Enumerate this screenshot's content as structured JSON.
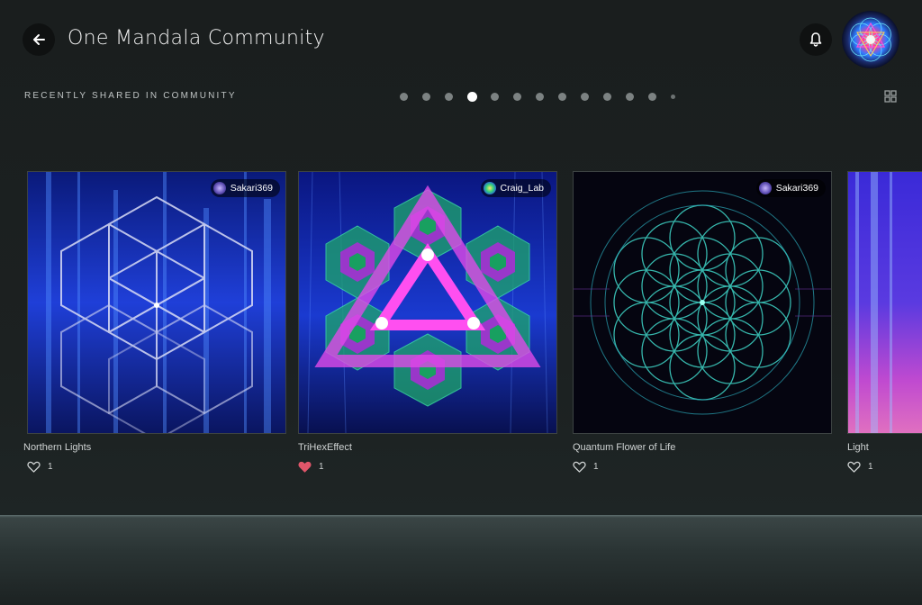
{
  "header": {
    "title": "One Mandala Community",
    "back_icon": "arrow-left-icon",
    "bell_icon": "bell-icon"
  },
  "section": {
    "label": "RECENTLY SHARED IN COMMUNITY",
    "page_dots_total": 13,
    "active_page": 4,
    "grid_icon": "grid-view-icon"
  },
  "cards": [
    {
      "title": "Northern Lights",
      "user": "Sakari369",
      "likes": "1",
      "liked": false
    },
    {
      "title": "TriHexEffect",
      "user": "Craig_Lab",
      "likes": "1",
      "liked": true
    },
    {
      "title": "Quantum Flower of Life",
      "user": "Sakari369",
      "likes": "1",
      "liked": false
    },
    {
      "title": "Light",
      "user": "",
      "likes": "1",
      "liked": false
    }
  ],
  "colors": {
    "background": "#1b1f1f",
    "accent_liked": "#e0566a",
    "dot_active": "#ffffff",
    "dot_inactive": "#7c8282"
  }
}
